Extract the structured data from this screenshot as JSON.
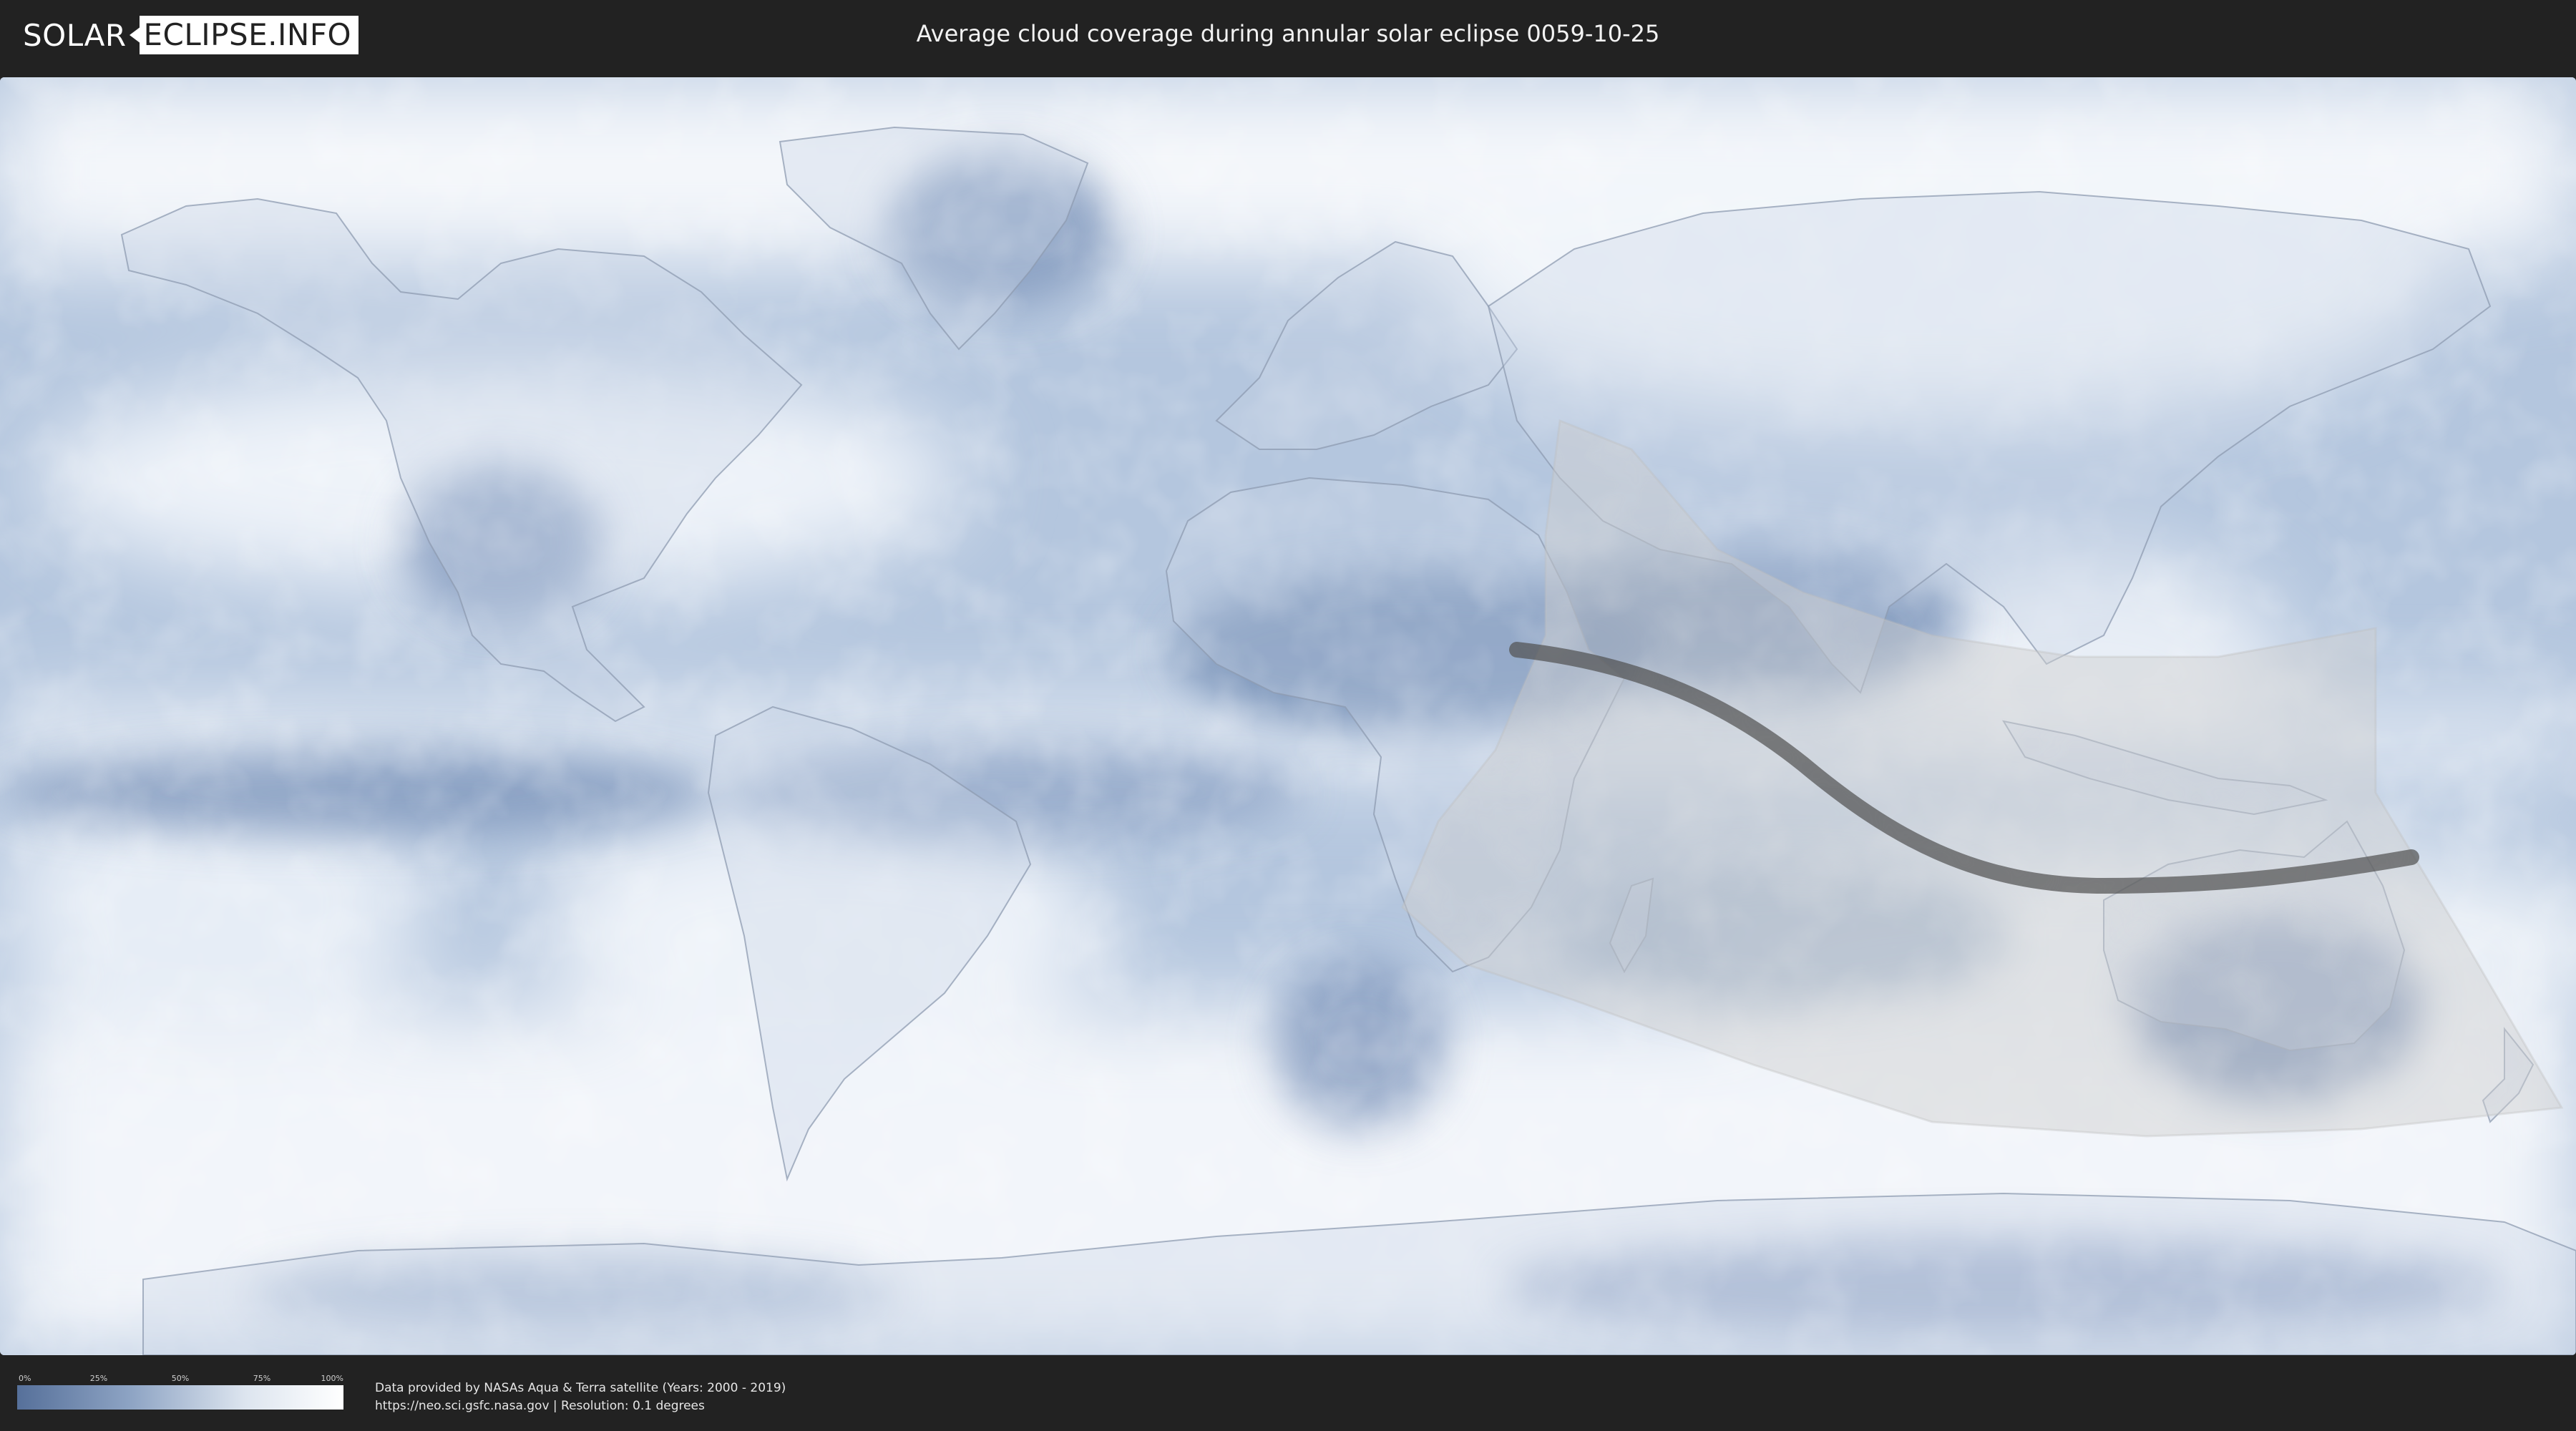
{
  "header": {
    "logo_left": "SOLAR",
    "logo_right": "ECLIPSE.INFO",
    "title": "Average cloud coverage during annular solar eclipse 0059-10-25"
  },
  "legend": {
    "ticks": [
      "0%",
      "25%",
      "50%",
      "75%",
      "100%"
    ],
    "colors": {
      "low": "#56709a",
      "mid": "#8ea4c4",
      "high": "#ffffff"
    }
  },
  "footer": {
    "credit_line1": "Data provided by NASAs Aqua & Terra satellite (Years: 2000 - 2019)",
    "credit_line2": "https://neo.sci.gsfc.nasa.gov | Resolution: 0.1 degrees"
  },
  "map": {
    "projection": "equirectangular",
    "eclipse_date": "0059-10-25",
    "eclipse_type": "annular",
    "colors": {
      "ocean_clear": "#9fb4d1",
      "cloud": "#f4f7fb",
      "land_clear": "#5d79a6",
      "shadow_band": "#c8c8c8",
      "center_line": "#505050"
    }
  }
}
